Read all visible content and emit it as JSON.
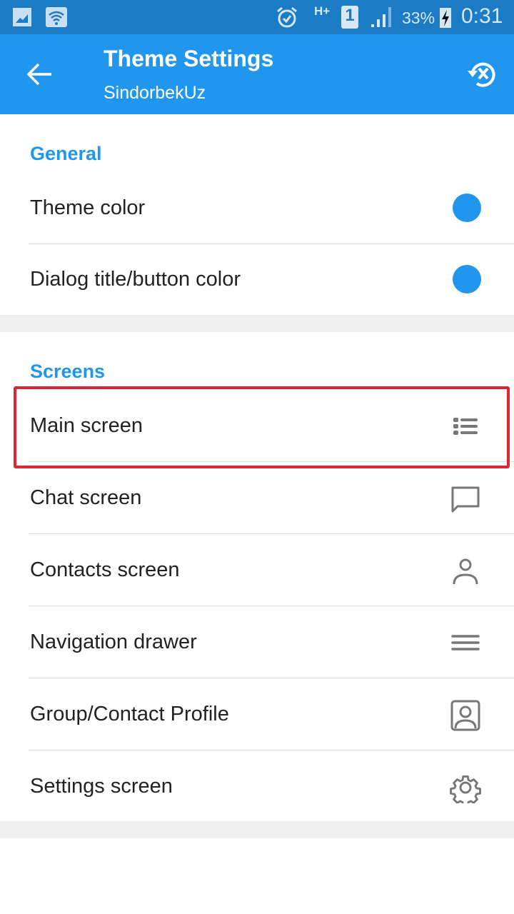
{
  "status_bar": {
    "battery": "33%",
    "time": "0:31",
    "sim": "1",
    "network": "H+"
  },
  "app_bar": {
    "title": "Theme Settings",
    "subtitle": "SindorbekUz"
  },
  "general": {
    "header": "General",
    "items": [
      {
        "label": "Theme color",
        "color": "#2196ee"
      },
      {
        "label": "Dialog title/button color",
        "color": "#2196ee"
      }
    ]
  },
  "screens": {
    "header": "Screens",
    "items": [
      {
        "label": "Main screen",
        "icon": "list-icon"
      },
      {
        "label": "Chat screen",
        "icon": "chat-bubble-icon"
      },
      {
        "label": "Contacts screen",
        "icon": "person-icon"
      },
      {
        "label": "Navigation drawer",
        "icon": "menu-icon"
      },
      {
        "label": "Group/Contact Profile",
        "icon": "profile-card-icon"
      },
      {
        "label": "Settings screen",
        "icon": "gear-icon"
      }
    ]
  }
}
